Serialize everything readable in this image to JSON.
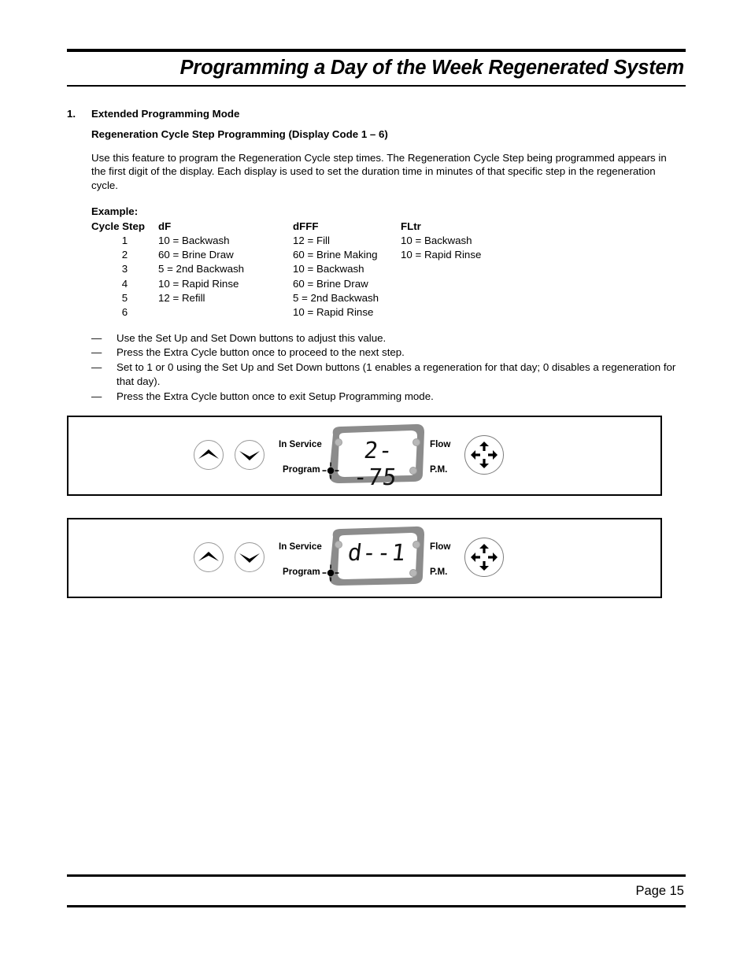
{
  "header": {
    "title": "Programming a Day of the Week Regenerated System"
  },
  "section": {
    "number": "1.",
    "heading": "Extended Programming Mode",
    "subheading": "Regeneration Cycle Step Programming (Display Code 1 – 6)",
    "paragraph": "Use this feature to program the Regeneration Cycle step times. The Regeneration Cycle Step being programmed appears in the first digit of the display. Each display is used to set the duration time in minutes of that specific step in the regeneration cycle.",
    "example_label": "Example:"
  },
  "cycle_table": {
    "headers": [
      "Cycle Step",
      "dF",
      "dFFF",
      "FLtr"
    ],
    "rows": [
      [
        "1",
        "10 = Backwash",
        "12 = Fill",
        "10 = Backwash"
      ],
      [
        "2",
        "60 = Brine Draw",
        "60 = Brine Making",
        "10 = Rapid Rinse"
      ],
      [
        "3",
        "5 = 2nd Backwash",
        "10 = Backwash",
        ""
      ],
      [
        "4",
        "10 = Rapid Rinse",
        "60 = Brine Draw",
        ""
      ],
      [
        "5",
        "12 = Refill",
        "5 = 2nd Backwash",
        ""
      ],
      [
        "6",
        "",
        "10 = Rapid Rinse",
        ""
      ]
    ]
  },
  "bullets": {
    "dash": "—",
    "items": [
      "Use the Set Up and Set Down buttons to adjust this value.",
      "Press the Extra Cycle button once to proceed to the next step.",
      "Set to 1 or 0 using the Set Up and Set Down buttons (1 enables a regeneration for that day; 0 disables a regeneration for that day).",
      "Press the Extra Cycle button once to exit Setup Programming mode."
    ]
  },
  "panels": [
    {
      "label_in_service": "In Service",
      "label_program": "Program",
      "label_flow": "Flow",
      "label_pm": "P.M.",
      "display_value": "2--75",
      "up_button": "set-up",
      "down_button": "set-down",
      "regen_button": "extra-cycle"
    },
    {
      "label_in_service": "In Service",
      "label_program": "Program",
      "label_flow": "Flow",
      "label_pm": "P.M.",
      "display_value": "d--1",
      "up_button": "set-up",
      "down_button": "set-down",
      "regen_button": "extra-cycle"
    }
  ],
  "footer": {
    "page_label": "Page 15"
  },
  "colors": {
    "text": "#000000",
    "bezel": "#8c8c8c",
    "lcd": "#ffffff",
    "lamp": "#b8b8b8"
  }
}
